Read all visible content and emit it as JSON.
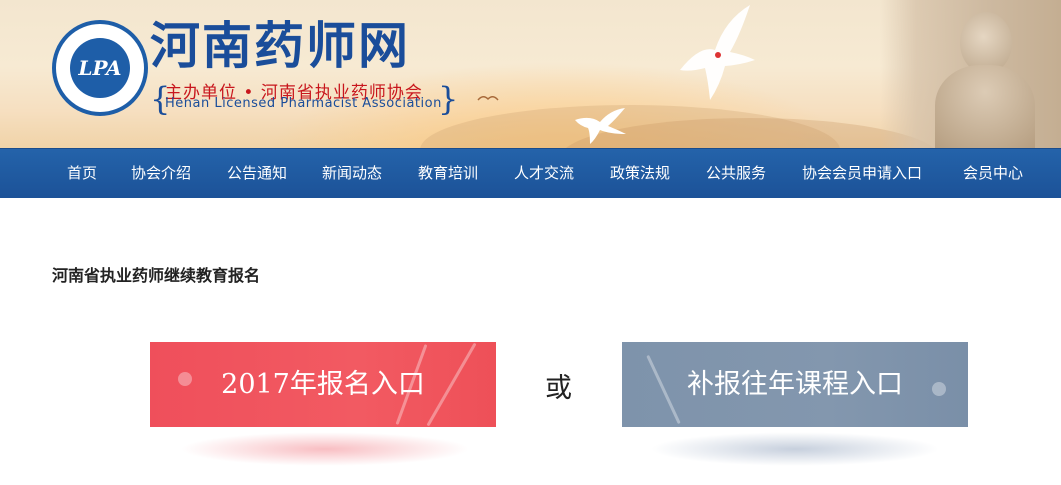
{
  "header": {
    "logo_text": "LPA",
    "title": "河南药师网",
    "organizer": "主办单位 • 河南省执业药师协会",
    "organizer_en": "Henan Licensed Pharmacist Association"
  },
  "nav": {
    "items": [
      {
        "label": "首页"
      },
      {
        "label": "协会介绍"
      },
      {
        "label": "公告通知"
      },
      {
        "label": "新闻动态"
      },
      {
        "label": "教育培训"
      },
      {
        "label": "人才交流"
      },
      {
        "label": "政策法规"
      },
      {
        "label": "公共服务"
      },
      {
        "label": "协会会员申请入口"
      },
      {
        "label": "会员中心"
      }
    ]
  },
  "main": {
    "heading": "河南省执业药师继续教育报名",
    "entry_2017_label": "2017年报名入口",
    "or_label": "或",
    "makeup_label": "补报往年课程入口"
  },
  "colors": {
    "nav_bg": "#1e58a0",
    "brand_blue": "#1a4d9a",
    "accent_red": "#ef4f5b",
    "button_blue_gray": "#8097ae"
  }
}
